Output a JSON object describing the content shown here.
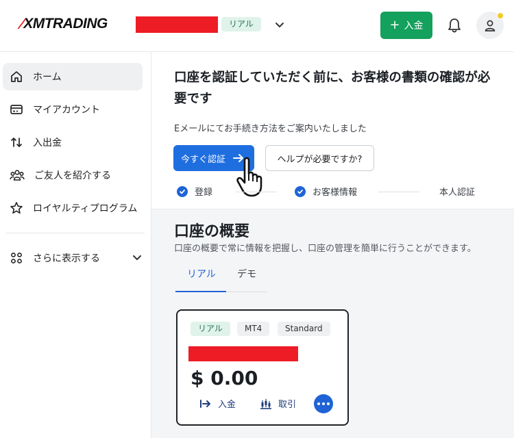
{
  "header": {
    "logo_text": "XMTRADING",
    "account_type_badge": "リアル",
    "deposit_button_label": "入金",
    "redaction_color": "#ee1c25",
    "accent_green": "#14a05d",
    "icons": [
      "chevron-down-icon",
      "plus-icon",
      "bell-icon",
      "user-icon"
    ]
  },
  "sidebar": {
    "items": [
      {
        "label": "ホーム",
        "icon": "home-icon",
        "active": true
      },
      {
        "label": "マイアカウント",
        "icon": "card-icon",
        "active": false
      },
      {
        "label": "入出金",
        "icon": "transfer-arrows-icon",
        "active": false
      },
      {
        "label": "ご友人を紹介する",
        "icon": "people-icon",
        "active": false
      },
      {
        "label": "ロイヤルティプログラム",
        "icon": "star-icon",
        "active": false
      },
      {
        "label": "さらに表示する",
        "icon": "grid-icon",
        "active": false
      }
    ]
  },
  "verification": {
    "title": "口座を認証していただく前に、お客様の書類の確認が必要です",
    "subtitle": "Eメールにてお手続き方法をご案内いたしました",
    "verify_button": "今すぐ認証",
    "help_button": "ヘルプが必要ですか?",
    "steps": [
      {
        "label": "登録",
        "done": true
      },
      {
        "label": "お客様情報",
        "done": true
      },
      {
        "label": "本人認証",
        "done": false
      }
    ],
    "accent_blue": "#1f6ee0"
  },
  "overview": {
    "title": "口座の概要",
    "subtitle": "口座の概要で常に情報を把握し、口座の管理を簡単に行うことができます。",
    "tabs": [
      {
        "label": "リアル",
        "active": true
      },
      {
        "label": "デモ",
        "active": false
      }
    ],
    "card": {
      "tags": [
        "リアル",
        "MT4",
        "Standard"
      ],
      "balance": "$ 0.00",
      "actions": [
        {
          "label": "入金",
          "icon": "deposit-arrow-icon"
        },
        {
          "label": "取引",
          "icon": "candlestick-icon"
        }
      ],
      "more_icon": "more-dots-icon"
    }
  }
}
